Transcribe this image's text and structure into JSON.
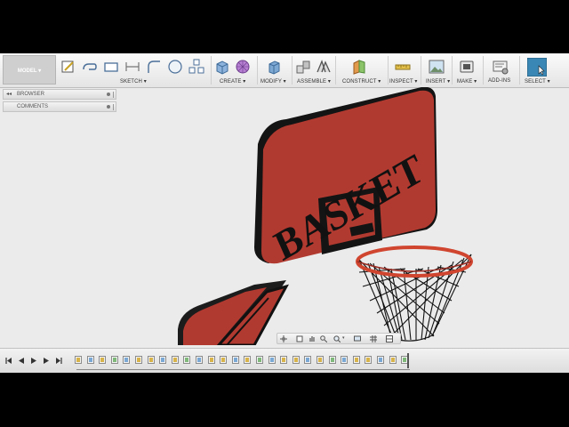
{
  "toolbar": {
    "model_label": "MODEL ▾",
    "groups": [
      {
        "label": "SKETCH ▾",
        "icon": "sketch-tools-icon"
      },
      {
        "label": "CREATE ▾",
        "icon": "create-box-icon"
      },
      {
        "label": "MODIFY ▾",
        "icon": "press-pull-icon"
      },
      {
        "label": "ASSEMBLE ▾",
        "icon": "joint-icon"
      },
      {
        "label": "CONSTRUCT ▾",
        "icon": "plane-icon"
      },
      {
        "label": "INSPECT ▾",
        "icon": "measure-icon"
      },
      {
        "label": "INSERT ▾",
        "icon": "insert-image-icon"
      },
      {
        "label": "MAKE ▾",
        "icon": "3d-print-icon"
      },
      {
        "label": "ADD-INS",
        "icon": "scripts-icon"
      },
      {
        "label": "SELECT ▾",
        "icon": "select-cursor-icon"
      }
    ]
  },
  "panels": {
    "browser_label": "BROWSER",
    "comments_label": "COMMENTS"
  },
  "model": {
    "backboard_text": "BASKET"
  },
  "colors": {
    "body_red": "#b13a30",
    "rim_red": "#d0452f",
    "frame_black": "#161616",
    "toolbar_bg": "#ececec",
    "canvas_bg": "#ebebeb",
    "select_blue": "#3a86b4"
  },
  "navbar": {
    "icons": [
      "orbit-icon",
      "look-at-icon",
      "pan-icon",
      "zoom-icon",
      "fit-icon",
      "display-settings-icon",
      "grid-icon",
      "viewports-icon"
    ]
  },
  "timeline": {
    "controls": [
      "go-to-start-icon",
      "step-back-icon",
      "play-icon",
      "step-forward-icon",
      "go-to-end-icon"
    ],
    "feature_count": 28
  }
}
